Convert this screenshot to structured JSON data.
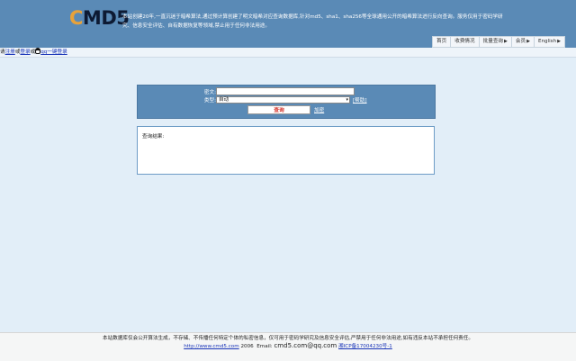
{
  "header": {
    "logo_lead": "C",
    "logo_rest": "MD5",
    "intro": "本站创建20年,一直沉迷于暗希算法,通过预计算创建了明文暗希对应查询数据库,针对md5、sha1、sha256等全球通用公开的暗希算法进行反向查询。服务仅用于密码学研究、信息安全评估、自有数据恢复等领域,禁止用于任何非法用途。",
    "nav": [
      {
        "label": "首页",
        "arrow": ""
      },
      {
        "label": "收费情况",
        "arrow": ""
      },
      {
        "label": "批量查询",
        "arrow": "▶"
      },
      {
        "label": "会员",
        "arrow": "▶"
      },
      {
        "label": "English",
        "arrow": "▶"
      }
    ]
  },
  "login_bar": {
    "prefix": "请",
    "register": "注册",
    "or1": "或",
    "login": "登录",
    "or2": "或",
    "qq_login": "qq一键登录"
  },
  "query": {
    "cipher_label": "密文:",
    "cipher_value": "",
    "type_label": "类型:",
    "type_value": "自动",
    "help_link": "[帮助]",
    "submit_label": "查询",
    "encrypt_link": "加密"
  },
  "result": {
    "label": "查询结果:"
  },
  "footer": {
    "disclaimer": "本站数据库仅会公开算法生成，不存储、不传播任何特定个体的私密信息，仅可用于密码学研究及信息安全评估,严禁用于任何非法用途,如有违反本站不承担任何责任。",
    "site_url": "http://www.cmd5.com",
    "year": "2006",
    "email_label": "Email:",
    "email": "cmd5.com@qq.com",
    "icp": "湘ICP备17004230号-1"
  }
}
